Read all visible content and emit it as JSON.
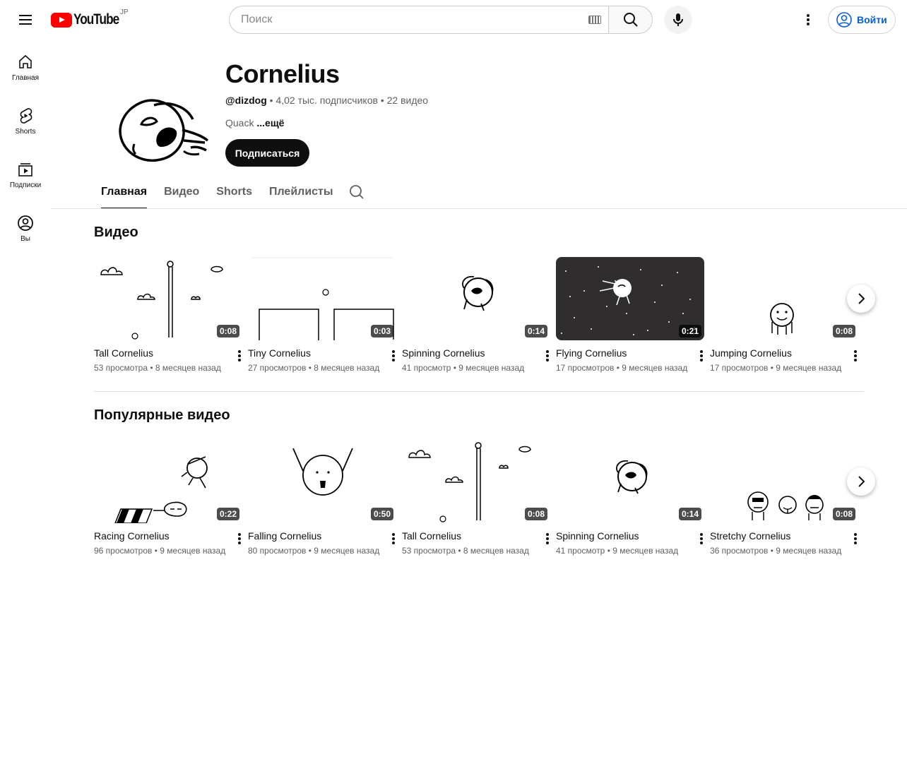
{
  "topbar": {
    "logo_text": "YouTube",
    "region": "JP",
    "search_placeholder": "Поиск",
    "signin_label": "Войти"
  },
  "sidebar": {
    "items": [
      {
        "label": "Главная",
        "icon": "home-icon"
      },
      {
        "label": "Shorts",
        "icon": "shorts-icon"
      },
      {
        "label": "Подписки",
        "icon": "subscriptions-icon"
      },
      {
        "label": "Вы",
        "icon": "you-icon"
      }
    ]
  },
  "channel": {
    "title": "Cornelius",
    "handle": "@dizdog",
    "subscribers": "4,02 тыс. подписчиков",
    "video_count": "22 видео",
    "description": "Quack",
    "more_label": "...ещё",
    "subscribe_label": "Подписаться"
  },
  "tabs": [
    "Главная",
    "Видео",
    "Shorts",
    "Плейлисты"
  ],
  "shelves": [
    {
      "title": "Видео",
      "videos": [
        {
          "title": "Tall Cornelius",
          "views": "53 просмотра",
          "age": "8 месяцев назад",
          "duration": "0:08"
        },
        {
          "title": "Tiny Cornelius",
          "views": "27 просмотров",
          "age": "8 месяцев назад",
          "duration": "0:03"
        },
        {
          "title": "Spinning Cornelius",
          "views": "41 просмотр",
          "age": "9 месяцев назад",
          "duration": "0:14"
        },
        {
          "title": "Flying Cornelius",
          "views": "17 просмотров",
          "age": "9 месяцев назад",
          "duration": "0:21"
        },
        {
          "title": "Jumping Cornelius",
          "views": "17 просмотров",
          "age": "9 месяцев назад",
          "duration": "0:08"
        }
      ]
    },
    {
      "title": "Популярные видео",
      "videos": [
        {
          "title": "Racing Cornelius",
          "views": "96 просмотров",
          "age": "9 месяцев назад",
          "duration": "0:22"
        },
        {
          "title": "Falling Cornelius",
          "views": "80 просмотров",
          "age": "9 месяцев назад",
          "duration": "0:50"
        },
        {
          "title": "Tall Cornelius",
          "views": "53 просмотра",
          "age": "8 месяцев назад",
          "duration": "0:08"
        },
        {
          "title": "Spinning Cornelius",
          "views": "41 просмотр",
          "age": "9 месяцев назад",
          "duration": "0:14"
        },
        {
          "title": "Stretchy Cornelius",
          "views": "36 просмотров",
          "age": "9 месяцев назад",
          "duration": "0:08"
        }
      ]
    }
  ],
  "meta_separator": "•",
  "colors": {
    "brand_red": "#ff0000",
    "link_blue": "#065fd4",
    "text_secondary": "#606060"
  }
}
